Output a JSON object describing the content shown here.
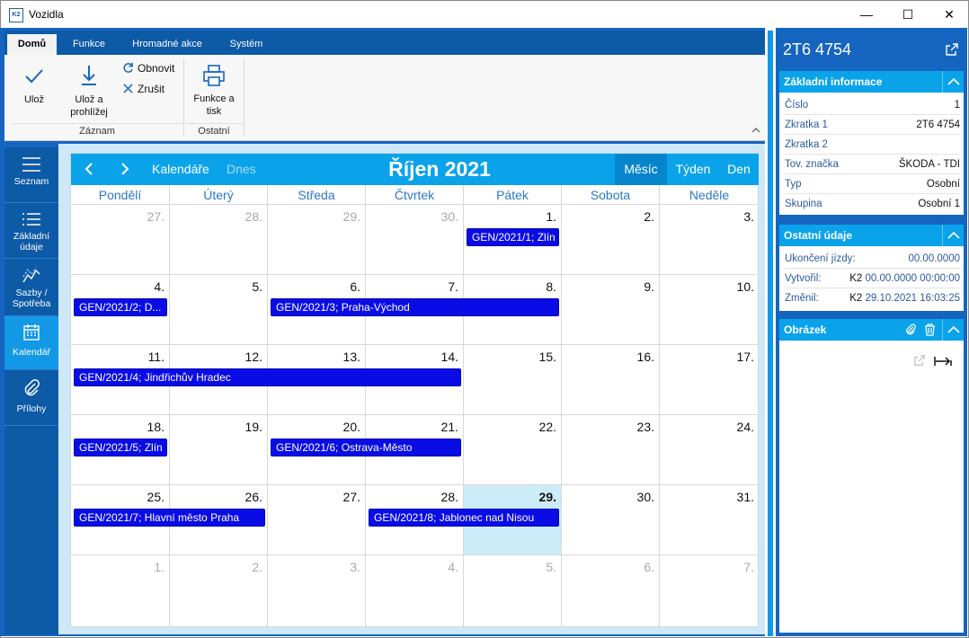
{
  "window": {
    "title": "Vozidla",
    "app_icon": "K2",
    "minimize": "—",
    "maximize": "☐",
    "close": "✕"
  },
  "ribbon": {
    "tabs": [
      "Domů",
      "Funkce",
      "Hromadné akce",
      "Systém"
    ],
    "active_tab": "Domů",
    "save": "Ulož",
    "save_view_1": "Ulož a",
    "save_view_2": "prohlížej",
    "refresh": "Obnovit",
    "cancel": "Zrušit",
    "print_1": "Funkce a",
    "print_2": "tisk",
    "group_record": "Záznam",
    "group_other": "Ostatní"
  },
  "leftnav": [
    {
      "label1": "Seznam",
      "label2": "",
      "icon": "list-icon"
    },
    {
      "label1": "Základní",
      "label2": "údaje",
      "icon": "details-icon"
    },
    {
      "label1": "Sazby /",
      "label2": "Spotřeba",
      "icon": "chart-icon"
    },
    {
      "label1": "Kalendář",
      "label2": "",
      "icon": "calendar-icon",
      "active": true
    },
    {
      "label1": "Přílohy",
      "label2": "",
      "icon": "paperclip-icon"
    }
  ],
  "calendar": {
    "calendars_label": "Kalendáře",
    "today_label": "Dnes",
    "title": "Říjen 2021",
    "views": [
      "Měsíc",
      "Týden",
      "Den"
    ],
    "active_view": "Měsíc",
    "weekdays": [
      "Pondělí",
      "Úterý",
      "Středa",
      "Čtvrtek",
      "Pátek",
      "Sobota",
      "Neděle"
    ],
    "weeks": [
      [
        "27.",
        "28.",
        "29.",
        "30.",
        "1.",
        "2.",
        "3."
      ],
      [
        "4.",
        "5.",
        "6.",
        "7.",
        "8.",
        "9.",
        "10."
      ],
      [
        "11.",
        "12.",
        "13.",
        "14.",
        "15.",
        "16.",
        "17."
      ],
      [
        "18.",
        "19.",
        "20.",
        "21.",
        "22.",
        "23.",
        "24."
      ],
      [
        "25.",
        "26.",
        "27.",
        "28.",
        "29.",
        "30.",
        "31."
      ],
      [
        "1.",
        "2.",
        "3.",
        "4.",
        "5.",
        "6.",
        "7."
      ]
    ],
    "today_cell": [
      4,
      4
    ],
    "events": [
      {
        "label": "GEN/2021/1; Zlín",
        "week": 0,
        "start": 4,
        "span": 1
      },
      {
        "label": "GEN/2021/2; D...",
        "week": 1,
        "start": 0,
        "span": 1
      },
      {
        "label": "GEN/2021/3; Praha-Východ",
        "week": 1,
        "start": 2,
        "span": 3
      },
      {
        "label": "GEN/2021/4; Jindřichův Hradec",
        "week": 2,
        "start": 0,
        "span": 4
      },
      {
        "label": "GEN/2021/5; Zlín",
        "week": 3,
        "start": 0,
        "span": 1
      },
      {
        "label": "GEN/2021/6; Ostrava-Město",
        "week": 3,
        "start": 2,
        "span": 2
      },
      {
        "label": "GEN/2021/7; Hlavní město Praha",
        "week": 4,
        "start": 0,
        "span": 2
      },
      {
        "label": "GEN/2021/8; Jablonec nad Nisou",
        "week": 4,
        "start": 3,
        "span": 2
      }
    ]
  },
  "panel": {
    "title": "2T6 4754",
    "basic": {
      "header": "Základní informace",
      "rows": [
        {
          "k": "Číslo",
          "v": "1"
        },
        {
          "k": "Zkratka 1",
          "v": "2T6 4754"
        },
        {
          "k": "Zkratka 2",
          "v": ""
        },
        {
          "k": "Tov. značka",
          "v": "ŠKODA - TDI"
        },
        {
          "k": "Typ",
          "v": "Osobní"
        },
        {
          "k": "Skupina",
          "v": "Osobní 1"
        }
      ]
    },
    "other": {
      "header": "Ostatní údaje",
      "end_label": "Ukončení jízdy:",
      "end_value": "00.00.0000",
      "created_label": "Vytvořil:",
      "created_user": "K2",
      "created_value": "00.00.0000 00:00:00",
      "changed_label": "Změnil:",
      "changed_user": "K2",
      "changed_value": "29.10.2021 16:03:25"
    },
    "image": {
      "header": "Obrázek"
    }
  }
}
